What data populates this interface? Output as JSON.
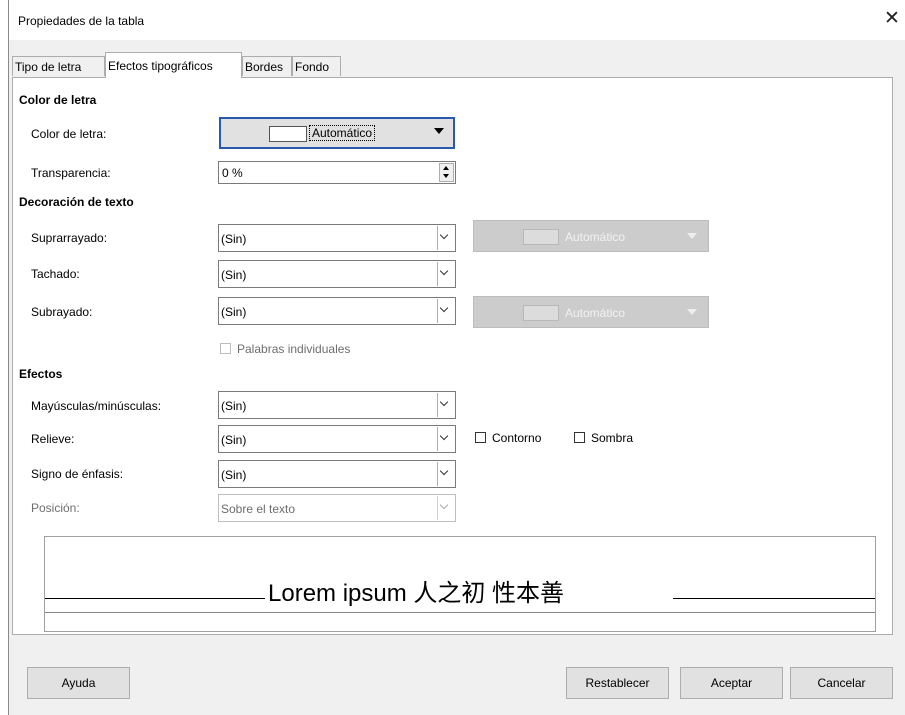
{
  "window": {
    "title": "Propiedades de la tabla",
    "close_glyph": "✕"
  },
  "tabs": [
    {
      "label": "Tipo de letra",
      "active": false
    },
    {
      "label": "Efectos tipográficos",
      "active": true
    },
    {
      "label": "Bordes",
      "active": false
    },
    {
      "label": "Fondo",
      "active": false
    }
  ],
  "font_color_section": {
    "header": "Color de letra",
    "color_label": "Color de letra:",
    "color_value": "Automático",
    "transparency_label": "Transparencia:",
    "transparency_value": "0 %"
  },
  "decoration_section": {
    "header": "Decoración de texto",
    "overline_label": "Suprarrayado:",
    "overline_value": "(Sin)",
    "overline_color": "Automático",
    "strikethrough_label": "Tachado:",
    "strikethrough_value": "(Sin)",
    "underline_label": "Subrayado:",
    "underline_value": "(Sin)",
    "underline_color": "Automático",
    "individual_words_label": "Palabras individuales"
  },
  "effects_section": {
    "header": "Efectos",
    "case_label": "Mayúsculas/minúsculas:",
    "case_value": "(Sin)",
    "relief_label": "Relieve:",
    "relief_value": "(Sin)",
    "outline_label": "Contorno",
    "shadow_label": "Sombra",
    "emphasis_label": "Signo de énfasis:",
    "emphasis_value": "(Sin)",
    "position_label": "Posición:",
    "position_value": "Sobre el texto"
  },
  "preview": {
    "text": "Lorem ipsum   人之初 性本善"
  },
  "buttons": {
    "help": "Ayuda",
    "reset": "Restablecer",
    "ok": "Aceptar",
    "cancel": "Cancelar"
  }
}
